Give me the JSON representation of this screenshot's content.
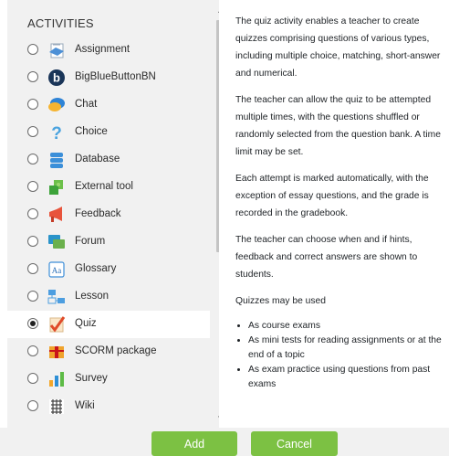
{
  "activities": {
    "heading": "ACTIVITIES",
    "items": [
      {
        "label": "Assignment",
        "icon": "assignment-icon",
        "selected": false
      },
      {
        "label": "BigBlueButtonBN",
        "icon": "bigbluebutton-icon",
        "selected": false
      },
      {
        "label": "Chat",
        "icon": "chat-icon",
        "selected": false
      },
      {
        "label": "Choice",
        "icon": "choice-icon",
        "selected": false
      },
      {
        "label": "Database",
        "icon": "database-icon",
        "selected": false
      },
      {
        "label": "External tool",
        "icon": "external-tool-icon",
        "selected": false
      },
      {
        "label": "Feedback",
        "icon": "feedback-icon",
        "selected": false
      },
      {
        "label": "Forum",
        "icon": "forum-icon",
        "selected": false
      },
      {
        "label": "Glossary",
        "icon": "glossary-icon",
        "selected": false
      },
      {
        "label": "Lesson",
        "icon": "lesson-icon",
        "selected": false
      },
      {
        "label": "Quiz",
        "icon": "quiz-icon",
        "selected": true
      },
      {
        "label": "SCORM package",
        "icon": "scorm-icon",
        "selected": false
      },
      {
        "label": "Survey",
        "icon": "survey-icon",
        "selected": false
      },
      {
        "label": "Wiki",
        "icon": "wiki-icon",
        "selected": false
      }
    ]
  },
  "description": {
    "p1": "The quiz activity enables a teacher to create quizzes comprising questions of various types, including multiple choice, matching, short-answer and numerical.",
    "p2": "The teacher can allow the quiz to be attempted multiple times, with the questions shuffled or randomly selected from the question bank. A time limit may be set.",
    "p3": "Each attempt is marked automatically, with the exception of essay questions, and the grade is recorded in the gradebook.",
    "p4": "The teacher can choose when and if hints, feedback and correct answers are shown to students.",
    "p5": "Quizzes may be used",
    "bullets": [
      "As course exams",
      "As mini tests for reading assignments or at the end of a topic",
      "As exam practice using questions from past exams"
    ]
  },
  "buttons": {
    "add": "Add",
    "cancel": "Cancel"
  },
  "colors": {
    "button_green": "#7cc143",
    "pane_bg": "#f1f1f1"
  }
}
